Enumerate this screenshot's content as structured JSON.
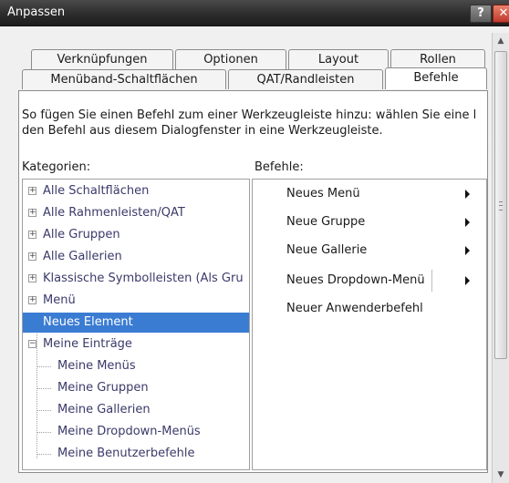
{
  "window": {
    "title": "Anpassen",
    "help_label": "?",
    "close_label": "✕"
  },
  "tabs": {
    "row1": [
      "Verknüpfungen",
      "Optionen",
      "Layout",
      "Rollen"
    ],
    "row2": [
      "Menüband-Schaltflächen",
      "QAT/Randleisten",
      "Befehle"
    ],
    "active": "Befehle"
  },
  "instruction": {
    "line1": "So fügen Sie einen Befehl zum einer Werkzeugleiste hinzu: wählen Sie eine l",
    "line2": "den Befehl aus diesem Dialogfenster in eine Werkzeugleiste."
  },
  "categories": {
    "label": "Kategorien:",
    "items": [
      {
        "label": "Alle Schaltflächen",
        "expander": "+",
        "selected": false
      },
      {
        "label": "Alle Rahmenleisten/QAT",
        "expander": "+",
        "selected": false
      },
      {
        "label": "Alle Gruppen",
        "expander": "+",
        "selected": false
      },
      {
        "label": "Alle Gallerien",
        "expander": "+",
        "selected": false
      },
      {
        "label": "Klassische Symbolleisten (Als Gru",
        "expander": "+",
        "selected": false
      },
      {
        "label": "Menü",
        "expander": "+",
        "selected": false
      },
      {
        "label": "Neues Element",
        "expander": "",
        "selected": true
      },
      {
        "label": "Meine Einträge",
        "expander": "−",
        "selected": false
      },
      {
        "label": "Meine Menüs",
        "expander": "",
        "selected": false
      },
      {
        "label": "Meine Gruppen",
        "expander": "",
        "selected": false
      },
      {
        "label": "Meine Gallerien",
        "expander": "",
        "selected": false
      },
      {
        "label": "Meine Dropdown-Menüs",
        "expander": "",
        "selected": false
      },
      {
        "label": "Meine Benutzerbefehle",
        "expander": "",
        "selected": false
      }
    ]
  },
  "commands": {
    "label": "Befehle:",
    "items": [
      {
        "label": "Neues Menü",
        "arrow": true
      },
      {
        "label": "Neue Gruppe",
        "arrow": true
      },
      {
        "label": "Neue Gallerie",
        "arrow": true
      },
      {
        "label": "Neues Dropdown-Menü",
        "arrow": true
      },
      {
        "label": "Neuer Anwenderbefehl",
        "arrow": false
      }
    ]
  },
  "colors": {
    "selection": "#3b7cd3",
    "titlebar": "#2c2c2c",
    "close": "#c0392b"
  }
}
